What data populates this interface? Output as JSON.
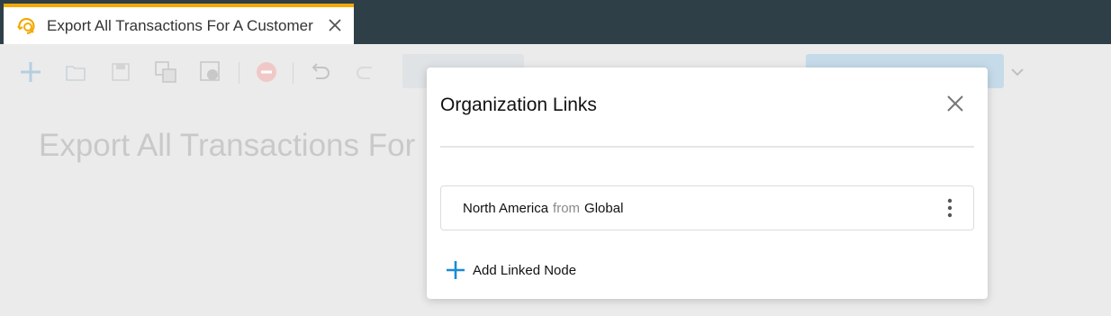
{
  "tab": {
    "title": "Export All Transactions For A Customer",
    "icon": "workflow-search-icon",
    "accent_color": "#f2a900"
  },
  "toolbar": {
    "icons": [
      "add-icon",
      "open-folder-icon",
      "save-icon",
      "copy-icon",
      "save-info-icon",
      "stop-icon",
      "undo-icon",
      "redo-icon"
    ]
  },
  "page": {
    "title": "Export All Transactions For"
  },
  "modal": {
    "title": "Organization Links",
    "links": [
      {
        "node": "North America",
        "connector": "from",
        "source": "Global"
      }
    ],
    "add_label": "Add Linked Node",
    "accent_color": "#1a8bd6"
  }
}
